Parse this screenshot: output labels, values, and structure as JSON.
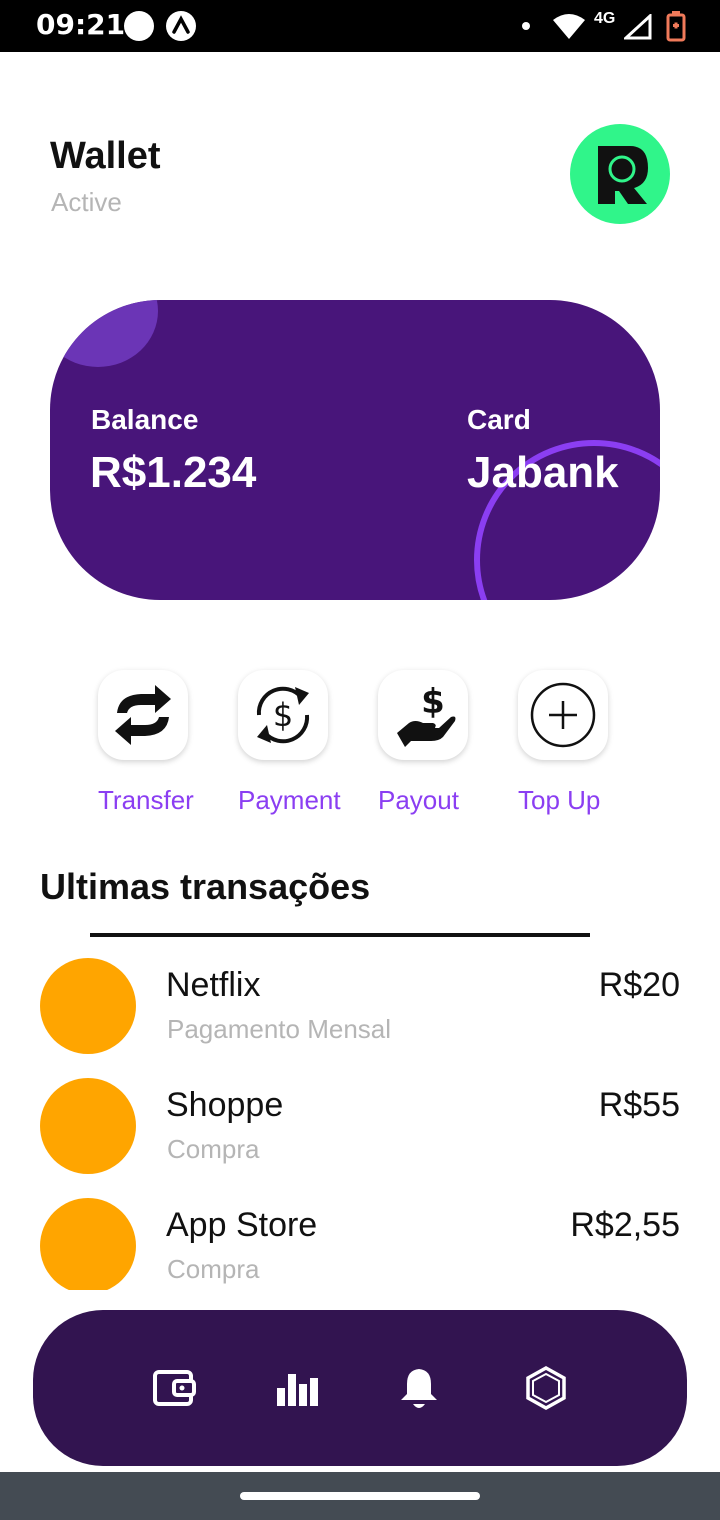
{
  "status_bar": {
    "time": "09:21",
    "network": "4G",
    "icons": [
      "notification-dot-icon",
      "app-notification-icon",
      "wifi-icon",
      "signal-icon",
      "battery-low-icon"
    ]
  },
  "header": {
    "title": "Wallet",
    "status": "Active",
    "avatar_icon": "profile-logo-icon"
  },
  "balance_card": {
    "balance_label": "Balance",
    "balance_value": "R$1.234",
    "card_label": "Card",
    "card_value": "Jabank"
  },
  "actions": [
    {
      "label": "Transfer",
      "icon": "transfer-icon"
    },
    {
      "label": "Payment",
      "icon": "payment-icon"
    },
    {
      "label": "Payout",
      "icon": "payout-icon"
    },
    {
      "label": "Top Up",
      "icon": "top-up-icon"
    }
  ],
  "transactions": {
    "title": "Ultimas transações",
    "items": [
      {
        "name": "Netflix",
        "description": "Pagamento Mensal",
        "amount": "R$20"
      },
      {
        "name": "Shoppe",
        "description": "Compra",
        "amount": "R$55"
      },
      {
        "name": "App Store",
        "description": "Compra",
        "amount": "R$2,55"
      }
    ]
  },
  "bottom_nav": {
    "items": [
      "wallet-icon",
      "stats-icon",
      "bell-icon",
      "hexagon-icon"
    ]
  },
  "colors": {
    "accent_purple": "#8b3ef2",
    "card_background": "#48157a",
    "nav_background": "#321450",
    "avatar_green": "#30f58a",
    "merchant_orange": "#ffa500"
  }
}
